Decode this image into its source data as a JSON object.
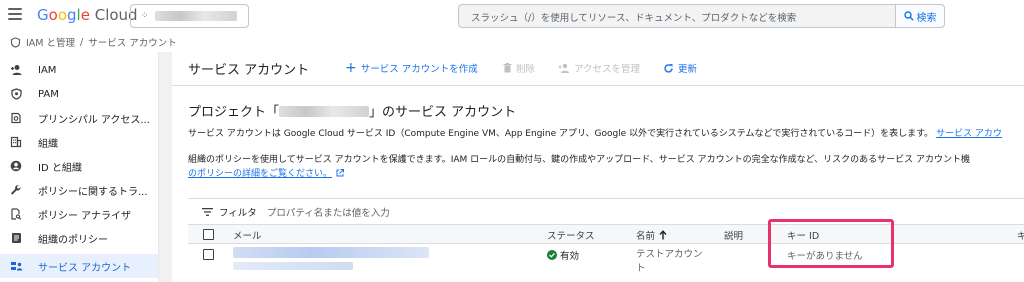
{
  "topbar": {
    "logo_brand": "Google",
    "logo_product": "Cloud",
    "search_placeholder": "スラッシュ（/）を使用してリソース、ドキュメント、プロダクトなどを検索",
    "search_button": "検索"
  },
  "breadcrumb": {
    "item1": "IAM と管理",
    "sep": "/",
    "item2": "サービス アカウント"
  },
  "sidebar": {
    "items": [
      {
        "label": "IAM",
        "icon": "person-add-icon"
      },
      {
        "label": "PAM",
        "icon": "shield-icon"
      },
      {
        "label": "プリンシパル アクセス...",
        "icon": "policy-icon"
      },
      {
        "label": "組織",
        "icon": "organization-icon"
      },
      {
        "label": "ID と組織",
        "icon": "account-circle-icon"
      },
      {
        "label": "ポリシーに関するトラ...",
        "icon": "wrench-icon"
      },
      {
        "label": "ポリシー アナライザ",
        "icon": "document-search-icon"
      },
      {
        "label": "組織のポリシー",
        "icon": "list-doc-icon"
      },
      {
        "label": "サービス アカウント",
        "icon": "service-account-icon",
        "active": true
      }
    ]
  },
  "main": {
    "title": "サービス アカウント",
    "toolbar": {
      "create": "サービス アカウントを作成",
      "delete": "削除",
      "access": "アクセスを管理",
      "refresh": "更新"
    },
    "heading_prefix": "プロジェクト「",
    "heading_suffix": "」のサービス アカウント",
    "desc1": "サービス アカウントは Google Cloud サービス ID（Compute Engine VM、App Engine アプリ、Google 以外で実行されているシステムなどで実行されているコード）を表します。",
    "desc1_link": "サービス アカウ",
    "desc2": "組織のポリシーを使用してサービス アカウントを保護できます。IAM ロールの自動付与、鍵の作成やアップロード、サービス アカウントの完全な作成など、リスクのあるサービス アカウント機",
    "desc2_link": "のポリシーの詳細をご覧ください。",
    "filter_label": "フィルタ",
    "filter_placeholder": "プロパティ名または値を入力",
    "columns": {
      "email": "メール",
      "status": "ステータス",
      "name": "名前",
      "desc": "説明",
      "keyid": "キー ID",
      "next": "キ"
    },
    "row": {
      "status": "有効",
      "name": "テストアカウント",
      "keyid": "キーがありません"
    }
  },
  "colors": {
    "accent": "#1a73e8",
    "active_bg": "#e8f0fe",
    "highlight": "#e8336a",
    "status_ok": "#188038"
  }
}
